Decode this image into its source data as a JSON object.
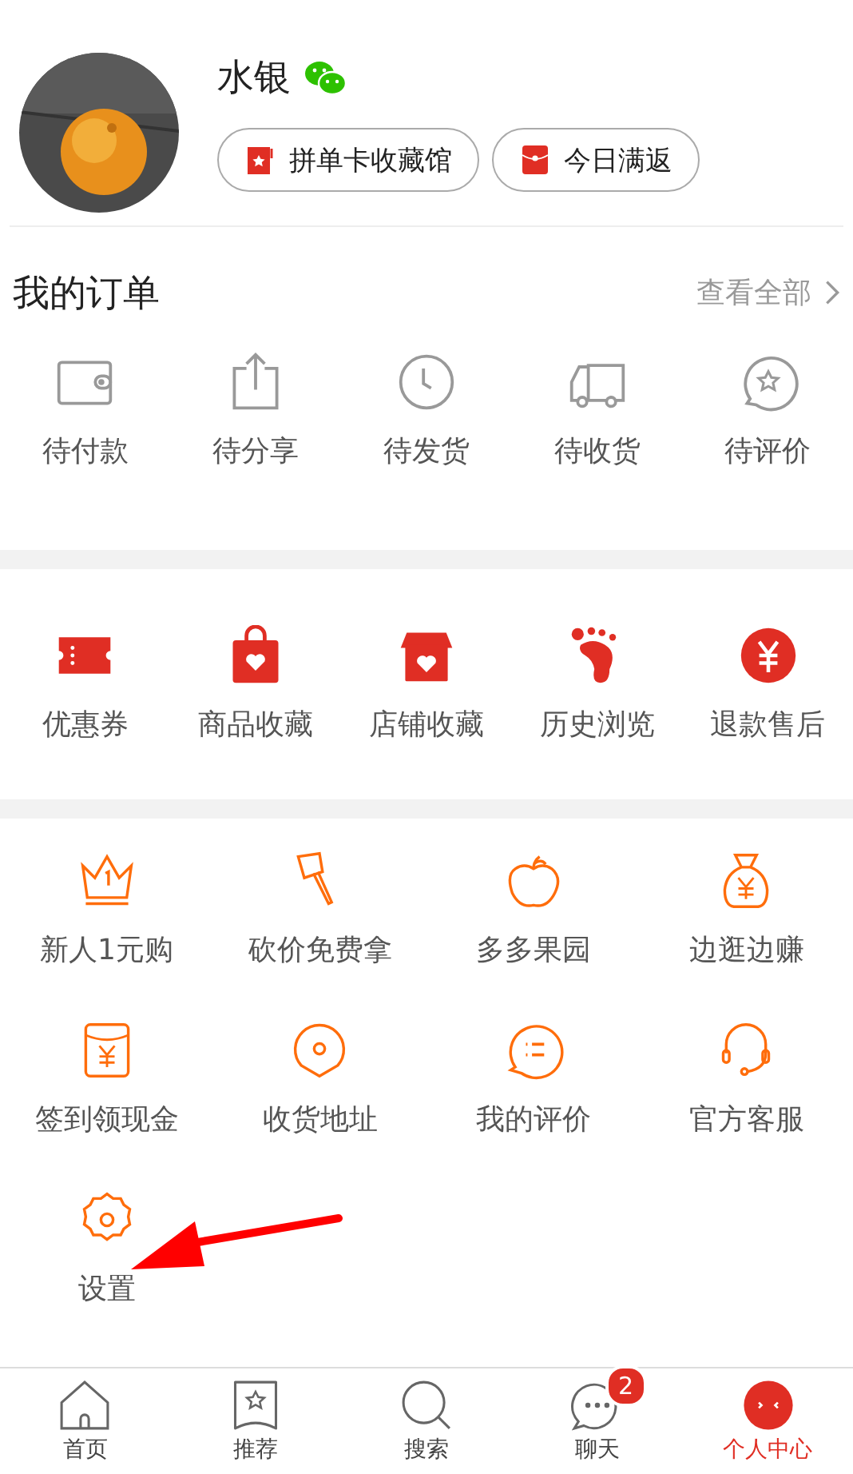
{
  "profile": {
    "name": "水银",
    "buttons": [
      "拼单卡收藏馆",
      "今日满返"
    ]
  },
  "orders": {
    "title": "我的订单",
    "view_all": "查看全部",
    "items": [
      "待付款",
      "待分享",
      "待发货",
      "待收货",
      "待评价"
    ]
  },
  "favorites": [
    "优惠券",
    "商品收藏",
    "店铺收藏",
    "历史浏览",
    "退款售后"
  ],
  "services": [
    "新人1元购",
    "砍价免费拿",
    "多多果园",
    "边逛边赚",
    "签到领现金",
    "收货地址",
    "我的评价",
    "官方客服",
    "设置"
  ],
  "tab_bar": [
    {
      "label": "首页",
      "selected": false
    },
    {
      "label": "推荐",
      "selected": false
    },
    {
      "label": "搜索",
      "selected": false
    },
    {
      "label": "聊天",
      "selected": false,
      "badge": "2"
    },
    {
      "label": "个人中心",
      "selected": true
    }
  ]
}
